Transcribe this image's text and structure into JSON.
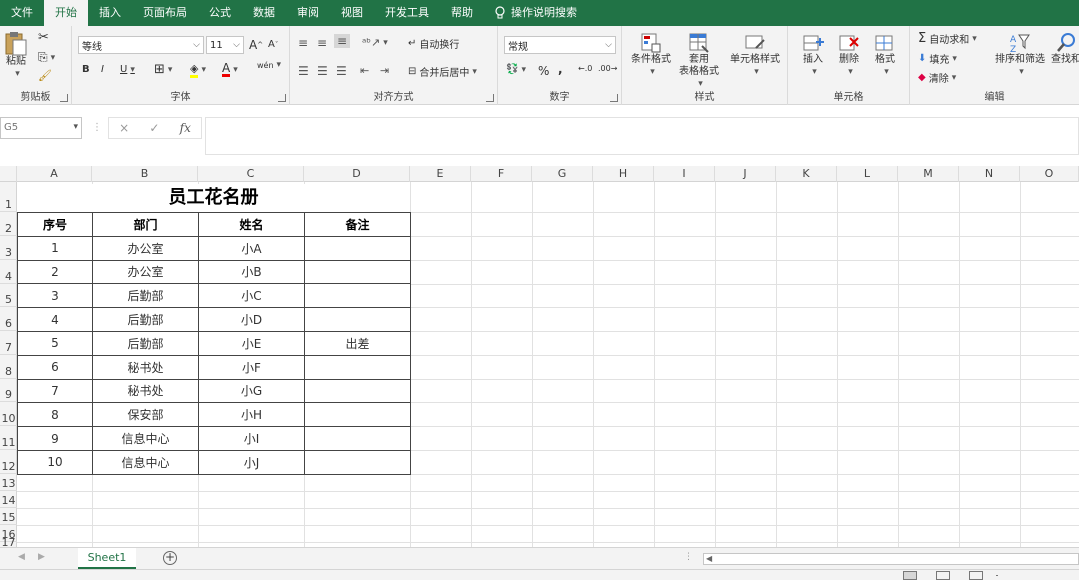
{
  "menu": {
    "tabs": [
      "文件",
      "开始",
      "插入",
      "页面布局",
      "公式",
      "数据",
      "审阅",
      "视图",
      "开发工具",
      "帮助"
    ],
    "active_tab": "开始",
    "search": "操作说明搜索"
  },
  "ribbon": {
    "clipboard": {
      "paste": "粘贴",
      "group_label": "剪贴板"
    },
    "font": {
      "name": "等线",
      "size": "11",
      "group_label": "字体",
      "bold": "B",
      "italic": "I",
      "underline": "U",
      "grow": "A",
      "shrink": "A",
      "font_color": "A",
      "phonetic": "wén"
    },
    "alignment": {
      "wrap": "自动换行",
      "merge": "合并后居中",
      "group_label": "对齐方式"
    },
    "number": {
      "format": "常规",
      "percent": "%",
      "comma": ",",
      "group_label": "数字"
    },
    "styles": {
      "conditional": "条件格式",
      "table_line1": "套用",
      "table_line2": "表格格式",
      "cell_styles": "单元格样式",
      "group_label": "样式"
    },
    "cells": {
      "insert": "插入",
      "delete": "删除",
      "format": "格式",
      "group_label": "单元格"
    },
    "editing": {
      "autosum": "自动求和",
      "fill": "填充",
      "clear": "清除",
      "sort": "排序和筛选",
      "find": "查找和",
      "group_label": "编辑"
    }
  },
  "formula_bar": {
    "name_box": "G5",
    "cancel": "×",
    "enter": "✓",
    "fx": "fx",
    "value": ""
  },
  "columns": [
    "A",
    "B",
    "C",
    "D",
    "E",
    "F",
    "G",
    "H",
    "I",
    "J",
    "K",
    "L",
    "M",
    "N",
    "O"
  ],
  "rows": [
    "1",
    "2",
    "3",
    "4",
    "5",
    "6",
    "7",
    "8",
    "9",
    "10",
    "11",
    "12",
    "13",
    "14",
    "15",
    "16",
    "17"
  ],
  "sheet": {
    "title": "员工花名册",
    "headers": [
      "序号",
      "部门",
      "姓名",
      "备注"
    ],
    "data": [
      [
        "1",
        "办公室",
        "小A",
        ""
      ],
      [
        "2",
        "办公室",
        "小B",
        ""
      ],
      [
        "3",
        "后勤部",
        "小C",
        ""
      ],
      [
        "4",
        "后勤部",
        "小D",
        ""
      ],
      [
        "5",
        "后勤部",
        "小E",
        "出差"
      ],
      [
        "6",
        "秘书处",
        "小F",
        ""
      ],
      [
        "7",
        "秘书处",
        "小G",
        ""
      ],
      [
        "8",
        "保安部",
        "小H",
        ""
      ],
      [
        "9",
        "信息中心",
        "小I",
        ""
      ],
      [
        "10",
        "信息中心",
        "小J",
        ""
      ]
    ]
  },
  "sheet_tabs": {
    "active": "Sheet1",
    "add": "+"
  },
  "colors": {
    "accent": "#217346",
    "ribbon_bg": "#f3f3f3",
    "grid_line": "#e1e1e1"
  }
}
